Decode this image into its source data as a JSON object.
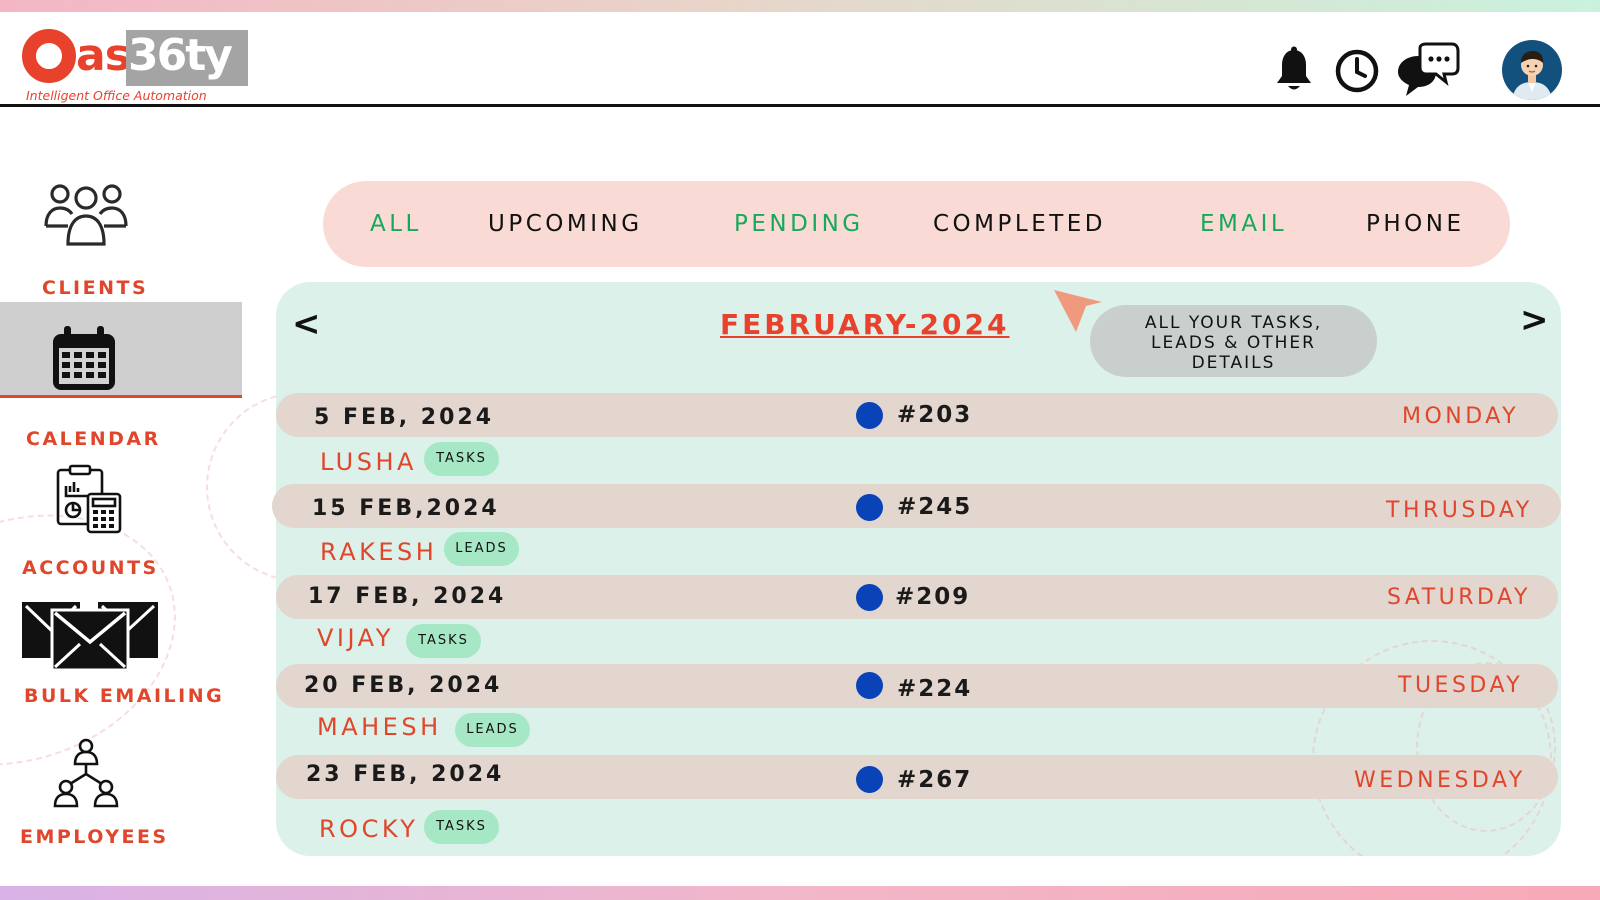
{
  "brand": {
    "logo_as": "as",
    "logo_number": "36ty",
    "tagline": "Intelligent Office Automation",
    "accent_color": "#e8412c"
  },
  "header": {
    "icons": [
      "bell-icon",
      "clock-icon",
      "chat-icon",
      "user-avatar"
    ]
  },
  "sidebar": {
    "items": [
      {
        "label": "CLIENTS",
        "icon": "clients-icon",
        "active": false
      },
      {
        "label": "CALENDAR",
        "icon": "calendar-icon",
        "active": true
      },
      {
        "label": "ACCOUNTS",
        "icon": "accounts-icon",
        "active": false
      },
      {
        "label": "BULK EMAILING",
        "icon": "envelope-icon",
        "active": false
      },
      {
        "label": "EMPLOYEES",
        "icon": "employees-icon",
        "active": false
      }
    ]
  },
  "filters": {
    "tabs": [
      {
        "label": "ALL",
        "color": "#18a85b"
      },
      {
        "label": "UPCOMING",
        "color": "#111111"
      },
      {
        "label": "PENDING",
        "color": "#18a85b"
      },
      {
        "label": "COMPLETED",
        "color": "#111111"
      },
      {
        "label": "EMAIL",
        "color": "#18a85b"
      },
      {
        "label": "PHONE",
        "color": "#111111"
      }
    ]
  },
  "calendar": {
    "prev_label": "<",
    "next_label": ">",
    "month": "FEBRUARY-2024",
    "tooltip_lines": [
      "ALL YOUR TASKS,",
      "LEADS & OTHER",
      "DETAILS"
    ],
    "entries": [
      {
        "date": "5 FEB, 2024",
        "id": "#203",
        "day": "MONDAY",
        "name": "LUSHA",
        "tag": "TASKS"
      },
      {
        "date": "15 FEB,2024",
        "id": "#245",
        "day": "THRUSDAY",
        "name": "RAKESH",
        "tag": "LEADS"
      },
      {
        "date": "17 FEB, 2024",
        "id": "#209",
        "day": "SATURDAY",
        "name": "VIJAY",
        "tag": "TASKS"
      },
      {
        "date": "20 FEB, 2024",
        "id": "#224",
        "day": "TUESDAY",
        "name": "MAHESH",
        "tag": "LEADS"
      },
      {
        "date": "23 FEB, 2024",
        "id": "#267",
        "day": "WEDNESDAY",
        "name": "ROCKY",
        "tag": "TASKS"
      }
    ]
  }
}
